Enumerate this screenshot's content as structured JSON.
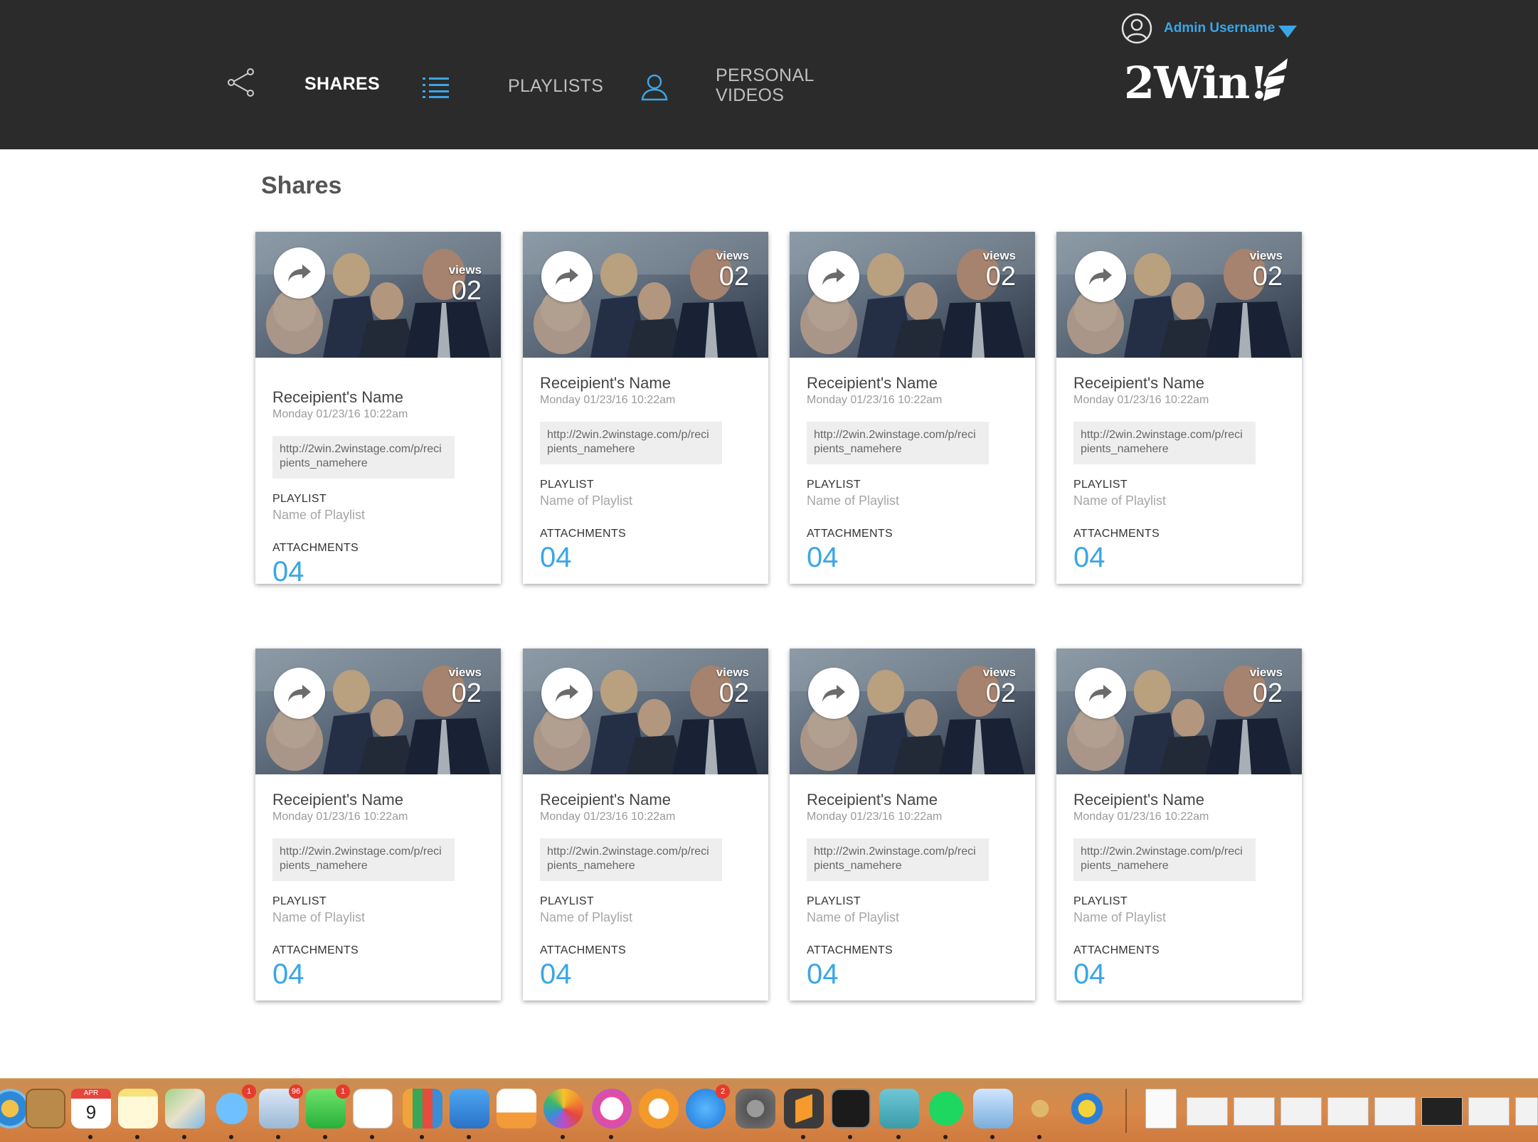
{
  "header": {
    "nav": [
      {
        "label": "SHARES",
        "icon": "share-icon",
        "active": true
      },
      {
        "label": "PLAYLISTS",
        "icon": "list-icon",
        "active": false
      },
      {
        "label": "PERSONAL VIDEOS",
        "icon": "user-icon",
        "active": false
      }
    ],
    "nav_personal_line1": "PERSONAL",
    "nav_personal_line2": "VIDEOS",
    "user": {
      "name": "Admin Username",
      "icon": "user-circle-icon",
      "menu_icon": "caret-down-icon"
    },
    "logo": "2Win!"
  },
  "page": {
    "title": "Shares"
  },
  "cards": [
    {
      "views_label": "views",
      "views": "02",
      "recipient": "Receipient's Name",
      "date": "Monday 01/23/16 10:22am",
      "link": "http://2win.2winstage.com/p/recipients_namehere",
      "playlist_label": "PLAYLIST",
      "playlist": "Name of Playlist",
      "attachments_label": "ATTACHMENTS",
      "attachments": "04"
    },
    {
      "views_label": "views",
      "views": "02",
      "recipient": "Receipient's Name",
      "date": "Monday 01/23/16 10:22am",
      "link": "http://2win.2winstage.com/p/recipients_namehere",
      "playlist_label": "PLAYLIST",
      "playlist": "Name of Playlist",
      "attachments_label": "ATTACHMENTS",
      "attachments": "04"
    },
    {
      "views_label": "views",
      "views": "02",
      "recipient": "Receipient's Name",
      "date": "Monday 01/23/16 10:22am",
      "link": "http://2win.2winstage.com/p/recipients_namehere",
      "playlist_label": "PLAYLIST",
      "playlist": "Name of Playlist",
      "attachments_label": "ATTACHMENTS",
      "attachments": "04"
    },
    {
      "views_label": "views",
      "views": "02",
      "recipient": "Receipient's Name",
      "date": "Monday 01/23/16 10:22am",
      "link": "http://2win.2winstage.com/p/recipients_namehere",
      "playlist_label": "PLAYLIST",
      "playlist": "Name of Playlist",
      "attachments_label": "ATTACHMENTS",
      "attachments": "04"
    },
    {
      "views_label": "views",
      "views": "02",
      "recipient": "Receipient's Name",
      "date": "Monday 01/23/16 10:22am",
      "link": "http://2win.2winstage.com/p/recipients_namehere",
      "playlist_label": "PLAYLIST",
      "playlist": "Name of Playlist",
      "attachments_label": "ATTACHMENTS",
      "attachments": "04"
    },
    {
      "views_label": "views",
      "views": "02",
      "recipient": "Receipient's Name",
      "date": "Monday 01/23/16 10:22am",
      "link": "http://2win.2winstage.com/p/recipients_namehere",
      "playlist_label": "PLAYLIST",
      "playlist": "Name of Playlist",
      "attachments_label": "ATTACHMENTS",
      "attachments": "04"
    },
    {
      "views_label": "views",
      "views": "02",
      "recipient": "Receipient's Name",
      "date": "Monday 01/23/16 10:22am",
      "link": "http://2win.2winstage.com/p/recipients_namehere",
      "playlist_label": "PLAYLIST",
      "playlist": "Name of Playlist",
      "attachments_label": "ATTACHMENTS",
      "attachments": "04"
    },
    {
      "views_label": "views",
      "views": "02",
      "recipient": "Receipient's Name",
      "date": "Monday 01/23/16 10:22am",
      "link": "http://2win.2winstage.com/p/recipients_namehere",
      "playlist_label": "PLAYLIST",
      "playlist": "Name of Playlist",
      "attachments_label": "ATTACHMENTS",
      "attachments": "04"
    }
  ],
  "dock": {
    "calendar_month": "APR",
    "calendar_day": "9",
    "badges": {
      "messages": "1",
      "mail": "96",
      "facetime": "1",
      "appstore": "2"
    },
    "apps": [
      "finder-icon",
      "contacts-icon",
      "calendar-icon",
      "notes-icon",
      "maps-icon",
      "messages-icon",
      "mail-icon",
      "facetime-icon",
      "reminders-icon",
      "numbers-icon",
      "keynote-icon",
      "pages-icon",
      "photos-icon",
      "itunes-icon",
      "ibooks-icon",
      "appstore-icon",
      "system-preferences-icon",
      "sublime-text-icon",
      "terminal-icon",
      "sketch-icon",
      "spotify-icon",
      "preview-icon",
      "keychain-icon",
      "app-icon"
    ]
  },
  "colors": {
    "header_bg": "#2b2b2b",
    "accent": "#3aa6e6",
    "page_bg": "#ffffff",
    "dock": "#d9894a"
  }
}
